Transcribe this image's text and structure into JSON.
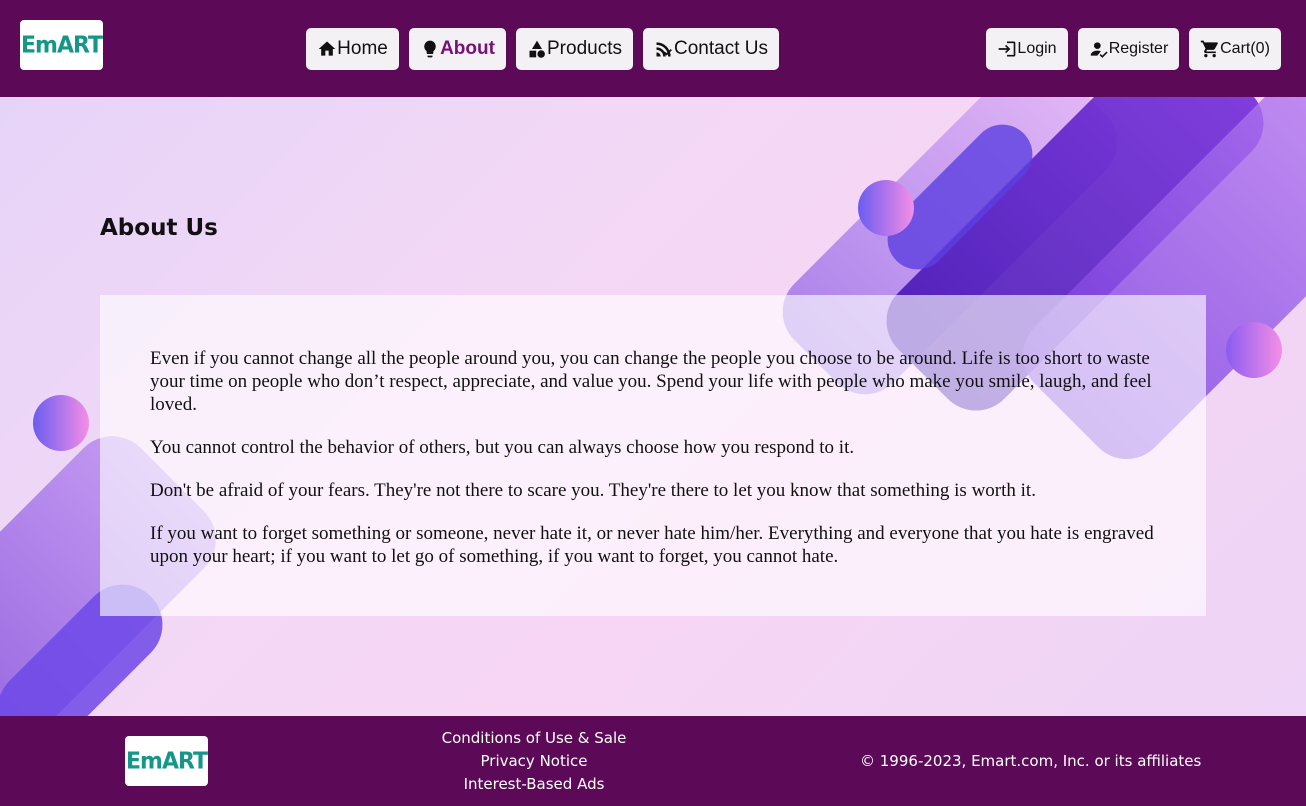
{
  "header": {
    "logo_text": "EmART",
    "nav": [
      {
        "label": "Home",
        "icon": "home-icon"
      },
      {
        "label": "About",
        "icon": "lightbulb-icon",
        "active": true
      },
      {
        "label": "Products",
        "icon": "shapes-icon"
      },
      {
        "label": "Contact Us",
        "icon": "contact-signal-icon"
      }
    ],
    "account": [
      {
        "label": "Login",
        "icon": "login-icon"
      },
      {
        "label": "Register",
        "icon": "register-user-icon"
      },
      {
        "label": "Cart(0)",
        "icon": "cart-icon"
      }
    ]
  },
  "main": {
    "title": "About Us",
    "paragraphs": [
      "Even if you cannot change all the people around you, you can change the people you choose to be around. Life is too short to waste your time on people who don’t respect, appreciate, and value you. Spend your life with people who make you smile, laugh, and feel loved.",
      "You cannot control the behavior of others, but you can always choose how you respond to it.",
      "Don't be afraid of your fears. They're not there to scare you. They're there to let you know that something is worth it.",
      "If you want to forget something or someone, never hate it, or never hate him/her. Everything and everyone that you hate is engraved upon your heart; if you want to let go of something, if you want to forget, you cannot hate."
    ]
  },
  "footer": {
    "logo_text": "EmART",
    "links": [
      "Conditions of Use & Sale",
      "Privacy Notice",
      "Interest-Based Ads"
    ],
    "copyright": "© 1996-2023, Emart.com, Inc. or its affiliates"
  },
  "colors": {
    "brand_purple": "#5c0a58",
    "active_nav": "#7a0f78",
    "logo_teal": "#169688"
  }
}
